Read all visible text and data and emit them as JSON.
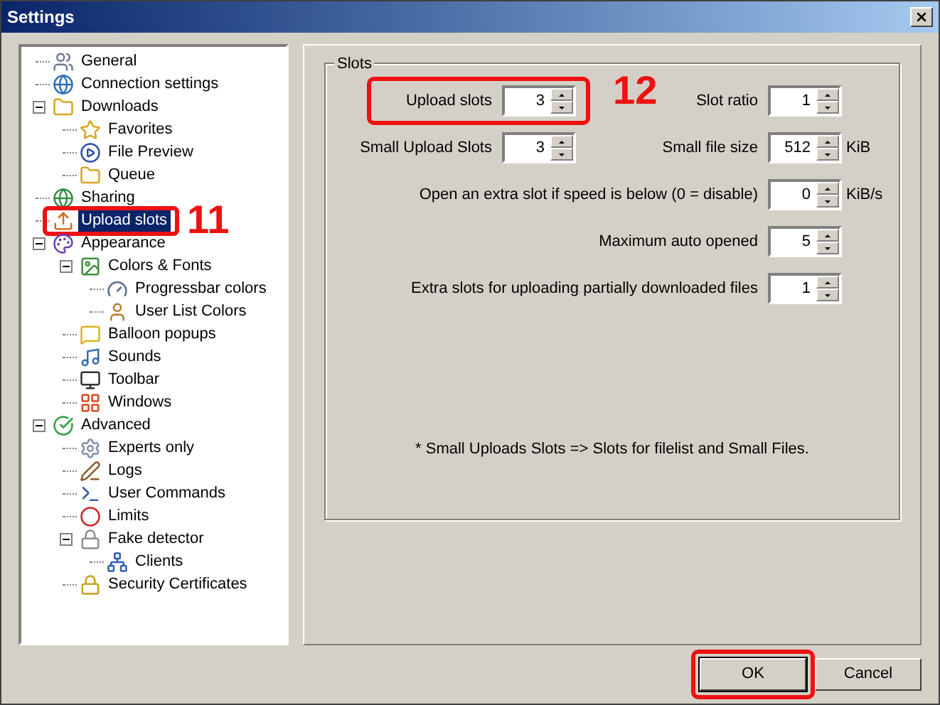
{
  "window": {
    "title": "Settings"
  },
  "tree": [
    {
      "label": "General",
      "selected": false,
      "outlined": false
    },
    {
      "label": "Connection settings",
      "selected": false,
      "outlined": false
    },
    {
      "label": "Downloads",
      "selected": false,
      "outlined": false,
      "expanded": true,
      "children": [
        {
          "label": "Favorites",
          "selected": false,
          "outlined": false
        },
        {
          "label": "File Preview",
          "selected": false,
          "outlined": false
        },
        {
          "label": "Queue",
          "selected": false,
          "outlined": false
        }
      ]
    },
    {
      "label": "Sharing",
      "selected": false,
      "outlined": false
    },
    {
      "label": "Upload slots",
      "selected": true,
      "outlined": true,
      "callout": "11"
    },
    {
      "label": "Appearance",
      "selected": false,
      "outlined": false,
      "expanded": true,
      "children": [
        {
          "label": "Colors & Fonts",
          "selected": false,
          "outlined": false,
          "expanded": true,
          "children": [
            {
              "label": "Progressbar colors",
              "selected": false,
              "outlined": false
            },
            {
              "label": "User List Colors",
              "selected": false,
              "outlined": false
            }
          ]
        },
        {
          "label": "Balloon popups",
          "selected": false,
          "outlined": false
        },
        {
          "label": "Sounds",
          "selected": false,
          "outlined": false
        },
        {
          "label": "Toolbar",
          "selected": false,
          "outlined": false
        },
        {
          "label": "Windows",
          "selected": false,
          "outlined": false
        }
      ]
    },
    {
      "label": "Advanced",
      "selected": false,
      "outlined": false,
      "expanded": true,
      "children": [
        {
          "label": "Experts only",
          "selected": false,
          "outlined": false
        },
        {
          "label": "Logs",
          "selected": false,
          "outlined": false
        },
        {
          "label": "User Commands",
          "selected": false,
          "outlined": false
        },
        {
          "label": "Limits",
          "selected": false,
          "outlined": false
        },
        {
          "label": "Fake detector",
          "selected": false,
          "outlined": false,
          "expanded": true,
          "children": [
            {
              "label": "Clients",
              "selected": false,
              "outlined": false
            }
          ]
        },
        {
          "label": "Security Certificates",
          "selected": false,
          "outlined": false
        }
      ]
    }
  ],
  "group": {
    "title": "Slots",
    "fields": [
      {
        "kind": "pair",
        "label": "Upload slots",
        "value": "3",
        "outlined": true,
        "callout": "12"
      },
      {
        "kind": "pair",
        "label": "Slot ratio",
        "value": "1",
        "outlined": false
      },
      {
        "kind": "pair",
        "label": "Small Upload Slots",
        "value": "3",
        "outlined": false
      },
      {
        "kind": "pair",
        "label": "Small file size",
        "value": "512",
        "unit": "KiB",
        "outlined": false
      },
      {
        "kind": "row",
        "label": "Open an extra slot if speed is below (0 = disable)",
        "value": "0",
        "unit": "KiB/s",
        "outlined": false
      },
      {
        "kind": "row",
        "label": "Maximum auto opened",
        "value": "5",
        "outlined": false
      },
      {
        "kind": "row",
        "label": "Extra slots for uploading partially downloaded files",
        "value": "1",
        "outlined": false
      }
    ],
    "note": "* Small Uploads Slots => Slots for filelist and Small Files."
  },
  "buttons": [
    {
      "label": "OK",
      "outlined": true
    },
    {
      "label": "Cancel",
      "outlined": false
    }
  ]
}
